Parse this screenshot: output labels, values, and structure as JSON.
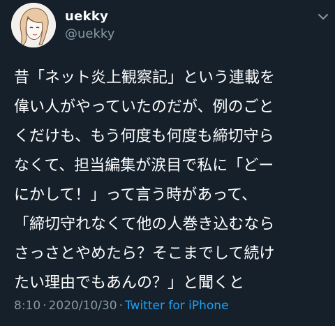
{
  "user": {
    "display_name": "uekky",
    "handle": "@uekky"
  },
  "more_icon": "chevron-down-icon",
  "tweet": {
    "lines": [
      "昔「ネット炎上観察記」という連載を",
      "偉い人がやっていたのだが、例のごと",
      "くだけも、もう何度も何度も締切守ら",
      "なくて、担当編集が涙目で私に「どー",
      "にかして！」って言う時があって、",
      "「締切守れなくて他の人巻き込むなら",
      "さっさとやめたら？そこまでして続け",
      "たい理由でもあんの？」と聞くと"
    ]
  },
  "meta": {
    "time": "8:10",
    "separator": "·",
    "date": "2020/10/30",
    "source": "Twitter for iPhone"
  },
  "colors": {
    "background": "#15202b",
    "text": "#ffffff",
    "secondary": "#8899a6",
    "link": "#1da1f2"
  }
}
